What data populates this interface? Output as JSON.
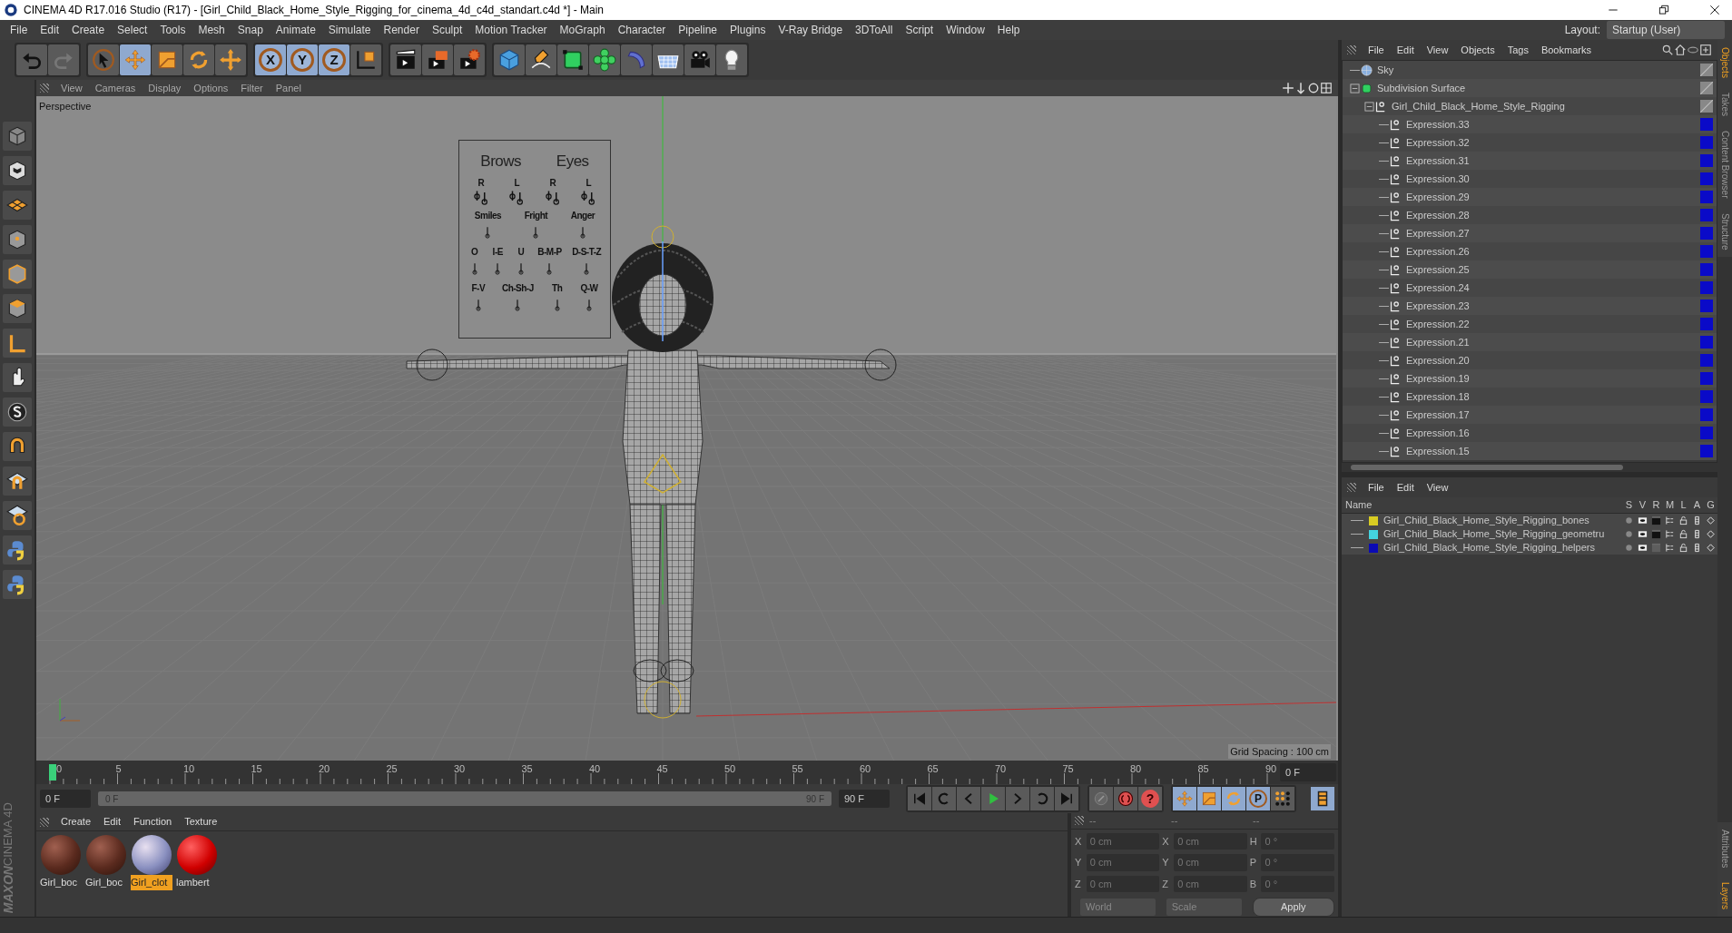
{
  "window": {
    "title": "CINEMA 4D R17.016 Studio (R17) - [Girl_Child_Black_Home_Style_Rigging_for_cinema_4d_c4d_standart.c4d *] - Main"
  },
  "menu_bar": {
    "items": [
      "File",
      "Edit",
      "Create",
      "Select",
      "Tools",
      "Mesh",
      "Snap",
      "Animate",
      "Simulate",
      "Render",
      "Sculpt",
      "Motion Tracker",
      "MoGraph",
      "Character",
      "Pipeline",
      "Plugins",
      "V-Ray Bridge",
      "3DToAll",
      "Script",
      "Window",
      "Help"
    ],
    "layout_label": "Layout:",
    "layout_value": "Startup (User)"
  },
  "toolbar": {
    "tools": [
      {
        "kind": "undo",
        "selected": false
      },
      {
        "kind": "redo",
        "selected": false
      },
      {
        "kind": "select",
        "selected": false
      },
      {
        "kind": "move",
        "selected": true
      },
      {
        "kind": "scale",
        "selected": false
      },
      {
        "kind": "rotate",
        "selected": false
      },
      {
        "kind": "transform",
        "selected": false
      },
      {
        "kind": "axis",
        "label": "X",
        "selected": true
      },
      {
        "kind": "axis",
        "label": "Y",
        "selected": true
      },
      {
        "kind": "axis",
        "label": "Z",
        "selected": true
      },
      {
        "kind": "coords",
        "selected": false
      },
      {
        "kind": "render_view",
        "selected": false
      },
      {
        "kind": "render_picture",
        "selected": false
      },
      {
        "kind": "render_settings",
        "selected": false
      },
      {
        "kind": "cube",
        "selected": false
      },
      {
        "kind": "pen",
        "selected": false
      },
      {
        "kind": "subdivision",
        "selected": false
      },
      {
        "kind": "array",
        "selected": false
      },
      {
        "kind": "deformer",
        "selected": false
      },
      {
        "kind": "floor",
        "selected": false
      },
      {
        "kind": "camera",
        "selected": false
      },
      {
        "kind": "light",
        "selected": false
      }
    ]
  },
  "viewport": {
    "menu": [
      "View",
      "Cameras",
      "Display",
      "Options",
      "Filter",
      "Panel"
    ],
    "camera_label": "Perspective",
    "grid_label": "Grid Spacing : 100 cm",
    "face_board": {
      "rows": [
        {
          "kind": "heading",
          "labels": [
            "Brows",
            "Eyes"
          ]
        },
        {
          "kind": "pair",
          "labels": [
            "R",
            "L",
            "R",
            "L"
          ]
        },
        {
          "kind": "control",
          "labels": [
            "Smiles",
            "Fright",
            "Anger"
          ]
        },
        {
          "kind": "control",
          "labels": [
            "O",
            "I-E",
            "U",
            "B-M-P",
            "D-S-T-Z"
          ]
        },
        {
          "kind": "control",
          "labels": [
            "F-V",
            "Ch-Sh-J",
            "Th",
            "Q-W"
          ]
        }
      ]
    }
  },
  "timeline": {
    "ticks": [
      "0",
      "5",
      "10",
      "15",
      "20",
      "25",
      "30",
      "35",
      "40",
      "45",
      "50",
      "55",
      "60",
      "65",
      "70",
      "75",
      "80",
      "85",
      "90"
    ],
    "current_frame": "0 F",
    "start_field": "0 F",
    "range": {
      "start_label": "0 F",
      "end_label": "90 F",
      "level": 1
    },
    "end_field": "90 F",
    "key_tools": [
      {
        "kind": "move",
        "selected": true
      },
      {
        "kind": "scale",
        "selected": true
      },
      {
        "kind": "rotate",
        "selected": true
      },
      {
        "kind": "param",
        "label": "P",
        "selected": true
      },
      {
        "kind": "points",
        "selected": false
      }
    ],
    "help_label": "?"
  },
  "materials": {
    "menu": [
      "Create",
      "Edit",
      "Function",
      "Texture"
    ],
    "items": [
      {
        "name": "Girl_boc",
        "kind": "skin",
        "selected": false
      },
      {
        "name": "Girl_boc",
        "kind": "skin",
        "selected": false
      },
      {
        "name": "Girl_clot",
        "kind": "cloth",
        "selected": true
      },
      {
        "name": "lambert",
        "kind": "red",
        "selected": false
      }
    ]
  },
  "coordinates": {
    "headers": [
      "--",
      "--",
      "--"
    ],
    "rows": [
      [
        {
          "axis": "X",
          "value": "0 cm"
        },
        {
          "axis": "X",
          "value": "0 cm"
        },
        {
          "axis": "H",
          "value": "0 °"
        }
      ],
      [
        {
          "axis": "Y",
          "value": "0 cm"
        },
        {
          "axis": "Y",
          "value": "0 cm"
        },
        {
          "axis": "P",
          "value": "0 °"
        }
      ],
      [
        {
          "axis": "Z",
          "value": "0 cm"
        },
        {
          "axis": "Z",
          "value": "0 cm"
        },
        {
          "axis": "B",
          "value": "0 °"
        }
      ]
    ],
    "dropdowns": [
      "World",
      "Scale"
    ],
    "apply": "Apply"
  },
  "objects": {
    "menu": [
      "File",
      "Edit",
      "View",
      "Objects",
      "Tags",
      "Bookmarks"
    ],
    "tree": [
      {
        "name": "Sky",
        "kind": "sky"
      },
      {
        "name": "Subdivision Surface",
        "kind": "subdivision",
        "expanded": true,
        "children": [
          {
            "name": "Girl_Child_Black_Home_Style_Rigging",
            "kind": "null",
            "expanded": true,
            "children": [
              {
                "name": "Expression.33",
                "kind": "null",
                "color": "#0a0ac8"
              },
              {
                "name": "Expression.32",
                "kind": "null",
                "color": "#0a0ac8"
              },
              {
                "name": "Expression.31",
                "kind": "null",
                "color": "#0a0ac8"
              },
              {
                "name": "Expression.30",
                "kind": "null",
                "color": "#0a0ac8"
              },
              {
                "name": "Expression.29",
                "kind": "null",
                "color": "#0a0ac8"
              },
              {
                "name": "Expression.28",
                "kind": "null",
                "color": "#0a0ac8"
              },
              {
                "name": "Expression.27",
                "kind": "null",
                "color": "#0a0ac8"
              },
              {
                "name": "Expression.26",
                "kind": "null",
                "color": "#0a0ac8"
              },
              {
                "name": "Expression.25",
                "kind": "null",
                "color": "#0a0ac8"
              },
              {
                "name": "Expression.24",
                "kind": "null",
                "color": "#0a0ac8"
              },
              {
                "name": "Expression.23",
                "kind": "null",
                "color": "#0a0ac8"
              },
              {
                "name": "Expression.22",
                "kind": "null",
                "color": "#0a0ac8"
              },
              {
                "name": "Expression.21",
                "kind": "null",
                "color": "#0a0ac8"
              },
              {
                "name": "Expression.20",
                "kind": "null",
                "color": "#0a0ac8"
              },
              {
                "name": "Expression.19",
                "kind": "null",
                "color": "#0a0ac8"
              },
              {
                "name": "Expression.18",
                "kind": "null",
                "color": "#0a0ac8"
              },
              {
                "name": "Expression.17",
                "kind": "null",
                "color": "#0a0ac8"
              },
              {
                "name": "Expression.16",
                "kind": "null",
                "color": "#0a0ac8"
              },
              {
                "name": "Expression.15",
                "kind": "null",
                "color": "#0a0ac8"
              }
            ]
          }
        ]
      }
    ]
  },
  "layers": {
    "menu": [
      "File",
      "Edit",
      "View"
    ],
    "columns": [
      "Name",
      "S",
      "V",
      "R",
      "M",
      "L",
      "A",
      "G"
    ],
    "rows": [
      {
        "name": "Girl_Child_Black_Home_Style_Rigging_bones",
        "color": "#d8cc22",
        "render": true
      },
      {
        "name": "Girl_Child_Black_Home_Style_Rigging_geometru",
        "color": "#44d4e0",
        "render": true
      },
      {
        "name": "Girl_Child_Black_Home_Style_Rigging_helpers",
        "color": "#0a0ab4",
        "render": false
      }
    ]
  },
  "side_tabs": {
    "upper": [
      {
        "label": "Objects",
        "selected": true
      },
      {
        "label": "Takes",
        "selected": false
      },
      {
        "label": "Content Browser",
        "selected": false
      },
      {
        "label": "Structure",
        "selected": false
      }
    ],
    "lower": [
      {
        "label": "Attributes",
        "selected": false
      },
      {
        "label": "Layers",
        "selected": true
      }
    ]
  },
  "logo": {
    "brand": "MAXON",
    "product": "CINEMA 4D"
  }
}
